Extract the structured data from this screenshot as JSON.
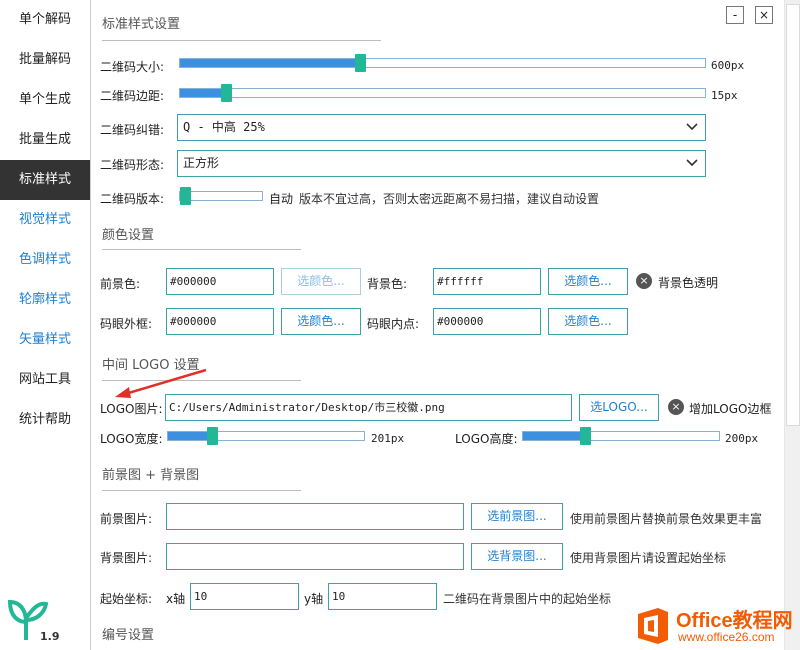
{
  "sidebar": {
    "items": [
      {
        "label": "单个解码",
        "style": "normal"
      },
      {
        "label": "批量解码",
        "style": "normal"
      },
      {
        "label": "单个生成",
        "style": "normal"
      },
      {
        "label": "批量生成",
        "style": "normal"
      },
      {
        "label": "标准样式",
        "style": "active"
      },
      {
        "label": "视觉样式",
        "style": "blue"
      },
      {
        "label": "色调样式",
        "style": "blue"
      },
      {
        "label": "轮廓样式",
        "style": "blue"
      },
      {
        "label": "矢量样式",
        "style": "blue"
      },
      {
        "label": "网站工具",
        "style": "normal"
      },
      {
        "label": "统计帮助",
        "style": "normal"
      }
    ],
    "logo_icon": "sprout-icon",
    "version": "1.9"
  },
  "window": {
    "minimize": "-",
    "close": "×"
  },
  "standard": {
    "title": "标准样式设置",
    "size": {
      "label": "二维码大小:",
      "value": "600px",
      "fraction": 0.34
    },
    "margin": {
      "label": "二维码边距:",
      "value": "15px",
      "fraction": 0.08
    },
    "ecc": {
      "label": "二维码纠错:",
      "value": "Q - 中高 25%"
    },
    "shape": {
      "label": "二维码形态:",
      "value": "正方形"
    },
    "version": {
      "label": "二维码版本:",
      "auto_text": "自动",
      "hint": "版本不宜过高，否则太密远距离不易扫描，建议自动设置",
      "fraction": 0.0
    }
  },
  "colors": {
    "title": "颜色设置",
    "fg_label": "前景色:",
    "fg_value": "#000000",
    "fg_button": "选颜色...",
    "bg_label": "背景色:",
    "bg_value": "#ffffff",
    "bg_button": "选颜色...",
    "bg_transparent": "背景色透明",
    "eye_frame_label": "码眼外框:",
    "eye_frame_value": "#000000",
    "eye_frame_button": "选颜色...",
    "eye_dot_label": "码眼内点:",
    "eye_dot_value": "#000000",
    "eye_dot_button": "选颜色..."
  },
  "logo": {
    "title": "中间 LOGO 设置",
    "image_label": "LOGO图片:",
    "image_path": "C:/Users/Administrator/Desktop/市三校徽.png",
    "image_button": "选LOGO...",
    "add_border": "增加LOGO边框",
    "width": {
      "label": "LOGO宽度:",
      "value": "201px",
      "fraction": 0.21
    },
    "height": {
      "label": "LOGO高度:",
      "value": "200px",
      "fraction": 0.31
    }
  },
  "images": {
    "title": "前景图 + 背景图",
    "fg_label": "前景图片:",
    "fg_value": "",
    "fg_button": "选前景图...",
    "fg_hint": "使用前景图片替换前景色效果更丰富",
    "bg_label": "背景图片:",
    "bg_value": "",
    "bg_button": "选背景图...",
    "bg_hint": "使用背景图片请设置起始坐标",
    "start_label": "起始坐标:",
    "x_label": "x轴",
    "x_value": "10",
    "y_label": "y轴",
    "y_value": "10",
    "start_hint": "二维码在背景图片中的起始坐标"
  },
  "numbering": {
    "title": "编号设置"
  },
  "watermark": {
    "icon": "office-logo-icon",
    "title": "Office教程网",
    "url": "www.office26.com"
  },
  "colors_theme": {
    "accent": "#3d8fdf",
    "thumb": "#21b797",
    "border": "#3fa0a8",
    "active_nav": "#333333",
    "arrow": "#e0302a",
    "office_orange": "#f25c05"
  }
}
